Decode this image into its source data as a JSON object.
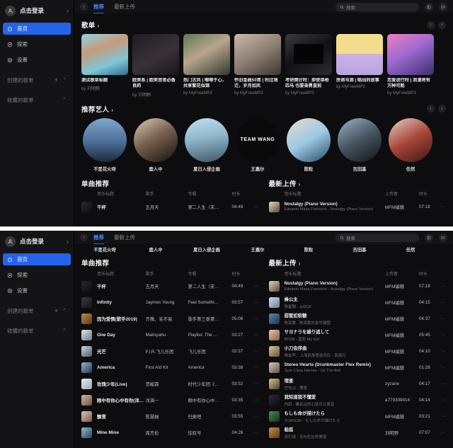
{
  "sidebar": {
    "login_label": "点击登录",
    "nav": [
      {
        "label": "首页",
        "icon": "home-icon",
        "active": true
      },
      {
        "label": "探索",
        "icon": "compass-icon",
        "active": false
      },
      {
        "label": "设置",
        "icon": "gear-icon",
        "active": false
      }
    ],
    "groups": [
      {
        "label": "创建的歌单",
        "has_plus": true
      },
      {
        "label": "收藏的歌单",
        "has_plus": false
      }
    ]
  },
  "topbar": {
    "back_arrow": "‹",
    "tabs": [
      {
        "label": "推荐",
        "active": true
      },
      {
        "label": "最新上传",
        "active": false
      }
    ],
    "search_placeholder": "搜索",
    "icons": [
      "layout-icon",
      "message-icon"
    ]
  },
  "playlists_section": {
    "title": "歌单",
    "arrow": "›",
    "prev": "‹",
    "next": "›",
    "cards": [
      {
        "title": "测试歌单标题",
        "by": "by 刘明野",
        "cover": "anime-girl"
      },
      {
        "title": "欧美系 | 欧美音者必备良药",
        "by": "by 刘明野",
        "cover": "dark"
      },
      {
        "title": "热门古风 | 啷啷于心，共享繁花似锦",
        "by": "by MyFreeMP3",
        "cover": "hanfu"
      },
      {
        "title": "怀旧金曲50首 | 时过境迁，岁月如风",
        "by": "by MyFreeMP3",
        "cover": "vintage"
      },
      {
        "title": "考研倒计时：即使单枪匹马 也要奋勇直前",
        "by": "by MyFreeMP3",
        "cover": "study"
      },
      {
        "title": "民谣与酒 | 唱出的故事",
        "by": "by MyFreeMP3",
        "cover": "pastel"
      },
      {
        "title": "恋爱进行时 | 浪漫将有万种可能",
        "by": "by MyFreeMP3",
        "cover": "pink-anime"
      }
    ]
  },
  "artists_section": {
    "title": "推荐艺人",
    "arrow": "›",
    "prev": "‹",
    "next": "›",
    "artists": [
      {
        "name": "不是花火呀",
        "avatar": "sky"
      },
      {
        "name": "鹿人中",
        "avatar": "portrait-man"
      },
      {
        "name": "夏日入侵企画",
        "avatar": "band"
      },
      {
        "name": "王嘉尔",
        "avatar": "team-wang"
      },
      {
        "name": "陈粒",
        "avatar": "hands-face"
      },
      {
        "name": "吉田基",
        "avatar": "man-dark"
      },
      {
        "name": "任然",
        "avatar": "red-hair"
      }
    ]
  },
  "singles_section": {
    "title": "单曲推荐",
    "columns": {
      "title": "音乐标题",
      "artist": "歌手",
      "album": "专辑",
      "duration": "时长"
    },
    "more_glyph": "···",
    "rows": [
      {
        "title": "干杯",
        "artist": "五月天",
        "album": "第二人生（末…",
        "duration": "04:49",
        "cover": "c1"
      },
      {
        "title": "Infinity",
        "artist": "Jaymes Young",
        "album": "Feel Somethi…",
        "duration": "03:57",
        "cover": "c2"
      },
      {
        "title": "因为爱情(歌手2019)",
        "artist": "齐豫、毛不易",
        "album": "歌手第三季第…",
        "duration": "05:08",
        "cover": "c3"
      },
      {
        "title": "One Day",
        "artist": "Matisyahu",
        "album": "Playlist: The …",
        "duration": "03:27",
        "cover": "c4"
      },
      {
        "title": "光芒",
        "artist": "F.I.R.飞儿乐团",
        "album": "飞儿乐团",
        "duration": "03:37",
        "cover": "c5"
      },
      {
        "title": "America",
        "artist": "First Aid Kit",
        "album": "America",
        "duration": "03:38",
        "cover": "c6"
      },
      {
        "title": "玫瑰少年(Live)",
        "artist": "贺峻霖",
        "album": "时代少年团《…",
        "duration": "03:52",
        "cover": "c7"
      },
      {
        "title": "眼中有你心中有你(洋满一版)",
        "artist": "洋满一",
        "album": "眼中有你心中…",
        "duration": "03:35",
        "cover": "c8"
      },
      {
        "title": "飘雪",
        "artist": "陈慧娴",
        "album": "归来吧",
        "duration": "03:55",
        "cover": "c9"
      },
      {
        "title": "Mine Mine",
        "artist": "周杰伦",
        "album": "惊叹号",
        "duration": "04:26",
        "cover": "c10"
      }
    ]
  },
  "latest_section": {
    "title": "最新上传",
    "arrow": "›",
    "columns": {
      "title": "音乐标题",
      "uploader": "上传者",
      "duration": "时长"
    },
    "more_glyph": "···",
    "rows": [
      {
        "title": "Nostalgy (Piano Version)",
        "sub": "Edoardo Maria Francioni - Nostalgy (Piano Version)",
        "uploader": "MFM编辑",
        "duration": "07:18",
        "cover": "p1"
      },
      {
        "title": "蜂公主",
        "sub": "陈星翰 - JyDGF",
        "uploader": "MFM编辑",
        "duration": "04:15",
        "cover": "p2"
      },
      {
        "title": "甜蜜如软糖",
        "sub": "陈亮雯 - 陈亮雯白金华凝固",
        "uploader": "MFM编辑",
        "duration": "04:37",
        "cover": "p3"
      },
      {
        "title": "サヨナラを繰り返して",
        "sub": "BTOB - 蓝色 My Girl",
        "uploader": "MFM编辑",
        "duration": "05:45",
        "cover": "p4"
      },
      {
        "title": "小刀会序曲",
        "sub": "林友声、上海民族管弦乐队 - 民族行",
        "uploader": "MFM编辑",
        "duration": "04:10",
        "cover": "p5"
      },
      {
        "title": "Stereo Hearts (Drunkmaster Flex Remix)",
        "sub": "Gym Class Heroes - Up The Anti",
        "uploader": "MFM编辑",
        "duration": "01:28",
        "cover": "p6"
      },
      {
        "title": "理查",
        "sub": "巴句山 - 理查",
        "uploader": "zyzane",
        "duration": "04:17",
        "cover": "p7"
      },
      {
        "title": "我知道我不懂爱",
        "sub": "内田 - 确名は的心弦可以爱音",
        "uploader": "a779309414",
        "duration": "04:14",
        "cover": "p8"
      },
      {
        "title": "もしも命が描けたら",
        "sub": "YOASOBI - もしも命が描けたら",
        "uploader": "MFM编辑",
        "duration": "03:21",
        "cover": "p9"
      },
      {
        "title": "船底",
        "sub": "苏打绿 - 无与伦比的美丽",
        "uploader": "刘明野",
        "duration": "07:07",
        "cover": "p10"
      }
    ]
  },
  "colors": {
    "accent": "#2563eb",
    "bg": "#0d0d0f",
    "sidebar_bg": "#141416",
    "text_primary": "#e9e9ec",
    "text_muted": "#76767d"
  }
}
